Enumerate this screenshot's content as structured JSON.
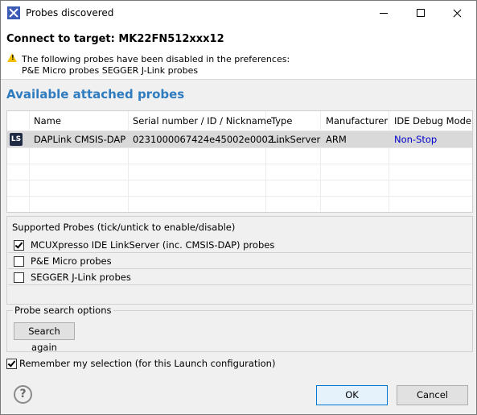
{
  "window": {
    "title": "Probes discovered"
  },
  "header": {
    "connect": "Connect to target: MK22FN512xxx12",
    "warning_line1": "The following probes have been disabled in the preferences:",
    "warning_line2": "P&E Micro probes SEGGER J-Link probes"
  },
  "section": {
    "title": "Available attached probes"
  },
  "table": {
    "columns": [
      "Name",
      "Serial number / ID / Nickname",
      "Type",
      "Manufacturer",
      "IDE Debug Mode"
    ],
    "rows": [
      {
        "icon": "LS",
        "name": "DAPLink CMSIS-DAP",
        "serial": "0231000067424e45002e0002...",
        "type": "LinkServer",
        "manufacturer": "ARM",
        "debug_mode": "Non-Stop"
      }
    ]
  },
  "supported": {
    "title": "Supported Probes (tick/untick to enable/disable)",
    "items": [
      {
        "label": "MCUXpresso IDE LinkServer (inc. CMSIS-DAP) probes",
        "checked": true
      },
      {
        "label": "P&E Micro probes",
        "checked": false
      },
      {
        "label": "SEGGER J-Link probes",
        "checked": false
      }
    ]
  },
  "search": {
    "title": "Probe search options",
    "button": "Search again"
  },
  "remember": {
    "label": "Remember my selection (for this Launch configuration)",
    "checked": true
  },
  "footer": {
    "help": "?",
    "ok": "OK",
    "cancel": "Cancel"
  },
  "colors": {
    "accent": "#2e7bbf",
    "link": "#0000cc",
    "selection": "#d9d9d9"
  }
}
